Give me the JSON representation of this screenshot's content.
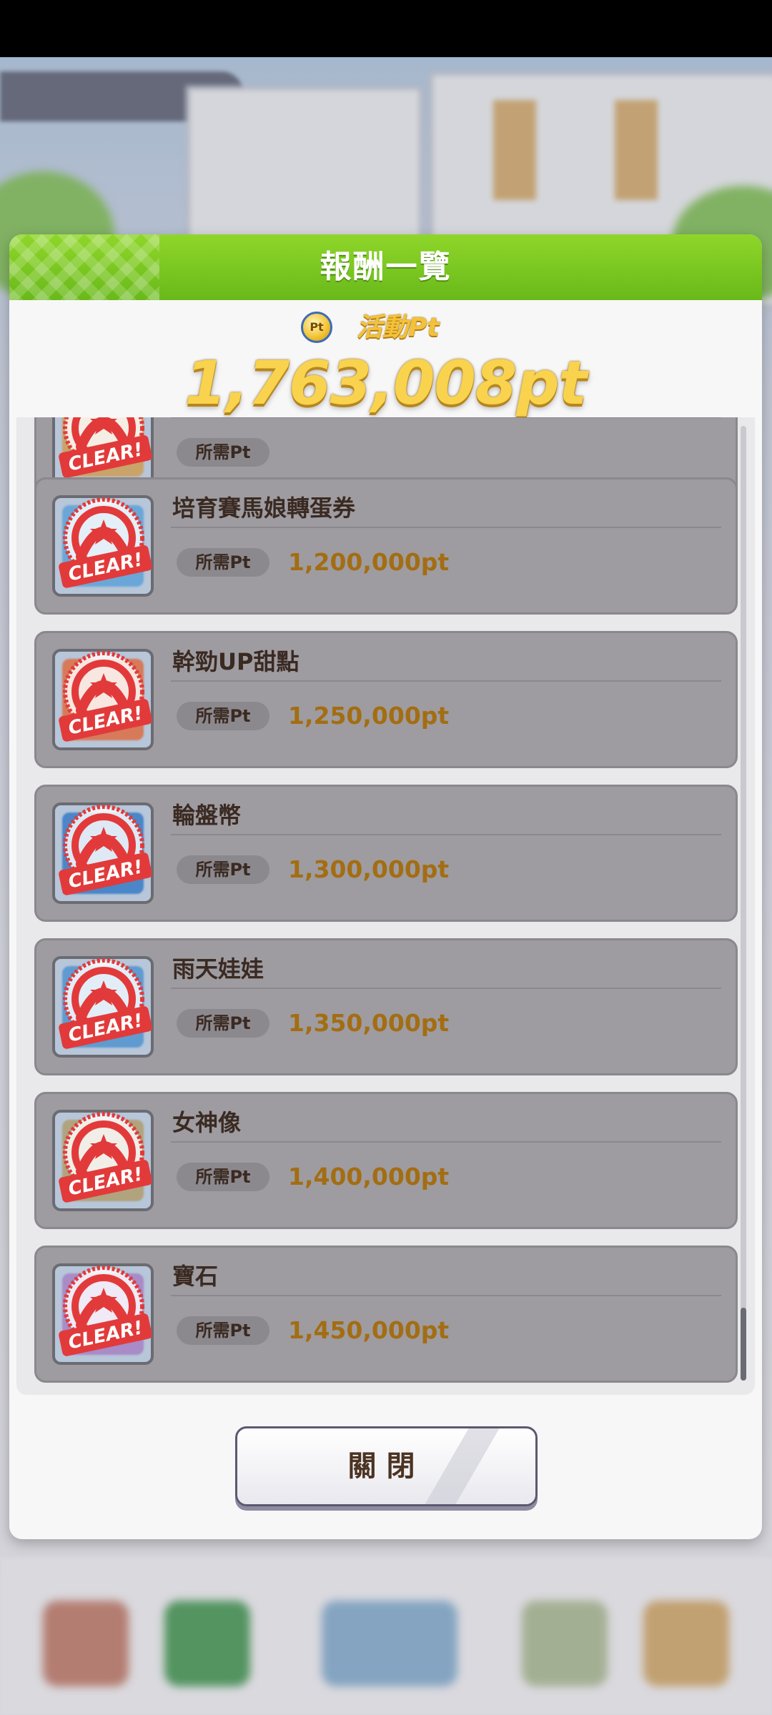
{
  "dialog": {
    "title": "報酬一覽",
    "event_pt_label": "活動Pt",
    "coin_label": "Pt",
    "event_pt_value": "1,763,008pt",
    "close_label": "關閉"
  },
  "rewards": [
    {
      "name": "",
      "req_label": "所需Pt",
      "req_value": "",
      "status": "CLEAR!"
    },
    {
      "name": "培育賽馬娘轉蛋券",
      "req_label": "所需Pt",
      "req_value": "1,200,000pt",
      "status": "CLEAR!"
    },
    {
      "name": "幹勁UP甜點",
      "req_label": "所需Pt",
      "req_value": "1,250,000pt",
      "status": "CLEAR!"
    },
    {
      "name": "輪盤幣",
      "req_label": "所需Pt",
      "req_value": "1,300,000pt",
      "status": "CLEAR!"
    },
    {
      "name": "雨天娃娃",
      "req_label": "所需Pt",
      "req_value": "1,350,000pt",
      "status": "CLEAR!"
    },
    {
      "name": "女神像",
      "req_label": "所需Pt",
      "req_value": "1,400,000pt",
      "status": "CLEAR!"
    },
    {
      "name": "寶石",
      "req_label": "所需Pt",
      "req_value": "1,450,000pt",
      "status": "CLEAR!"
    }
  ],
  "colors": {
    "header_green": "#7cc91f",
    "item_bg": "#9e9ca1",
    "pt_gold": "#f9d34d",
    "req_value_text": "#a36d12",
    "clear_red": "#e23a3a"
  },
  "icons": [
    "event-pt-coin-icon",
    "clear-stamp-icon"
  ]
}
